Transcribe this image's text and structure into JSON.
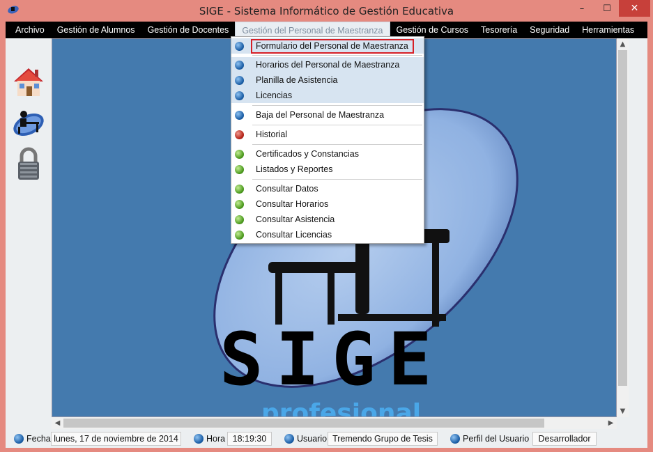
{
  "window": {
    "title": "SIGE - Sistema Informático de Gestión Educativa",
    "minimize": "–",
    "maximize": "☐",
    "close": "✕"
  },
  "menubar": {
    "items": [
      {
        "label": "Archivo"
      },
      {
        "label": "Gestión de  Alumnos"
      },
      {
        "label": "Gestión de Docentes"
      },
      {
        "label": "Gestión del Personal de Maestranza",
        "active": true
      },
      {
        "label": "Gestión de Cursos"
      },
      {
        "label": "Tesorería"
      },
      {
        "label": "Seguridad"
      },
      {
        "label": "Herramientas"
      }
    ]
  },
  "toolbar": {
    "items": [
      {
        "icon": "house-icon"
      },
      {
        "icon": "user-at-desk-icon"
      },
      {
        "icon": "padlock-icon"
      }
    ]
  },
  "dropdown": {
    "items": [
      {
        "label": "Formulario del Personal de Maestranza",
        "dot": "blue",
        "highlighted": true,
        "boxed": true
      },
      {
        "label": "Horarios del Personal de Maestranza",
        "dot": "blue",
        "highlighted": true
      },
      {
        "label": "Planilla de Asistencia",
        "dot": "blue",
        "highlighted": true
      },
      {
        "label": "Licencias",
        "dot": "blue",
        "highlighted": true
      },
      {
        "label": "Baja del Personal de Maestranza",
        "dot": "blue"
      },
      {
        "label": "Historial",
        "dot": "red"
      },
      {
        "label": "Certificados y Constancias",
        "dot": "green"
      },
      {
        "label": "Listados y Reportes",
        "dot": "green"
      },
      {
        "label": "Consultar Datos",
        "dot": "green"
      },
      {
        "label": "Consultar Horarios",
        "dot": "green"
      },
      {
        "label": "Consultar Asistencia",
        "dot": "green"
      },
      {
        "label": "Consultar Licencias",
        "dot": "green"
      }
    ]
  },
  "background_logo": {
    "title": "SIGE",
    "subtitle": "profesional"
  },
  "statusbar": {
    "fecha_label": "Fecha",
    "fecha_value": "lunes, 17 de noviembre de 2014",
    "hora_label": "Hora",
    "hora_value": "18:19:30",
    "usuario_label": "Usuario",
    "usuario_value": "Tremendo Grupo de Tesis",
    "perfil_label": "Perfil del Usuario",
    "perfil_value": "Desarrollador"
  },
  "colors": {
    "window_frame": "#e58a80",
    "menubar_bg": "#000000",
    "canvas_bg": "#447aae",
    "menu_highlight": "#d7e4f1",
    "focus_outline": "#d61f26"
  }
}
